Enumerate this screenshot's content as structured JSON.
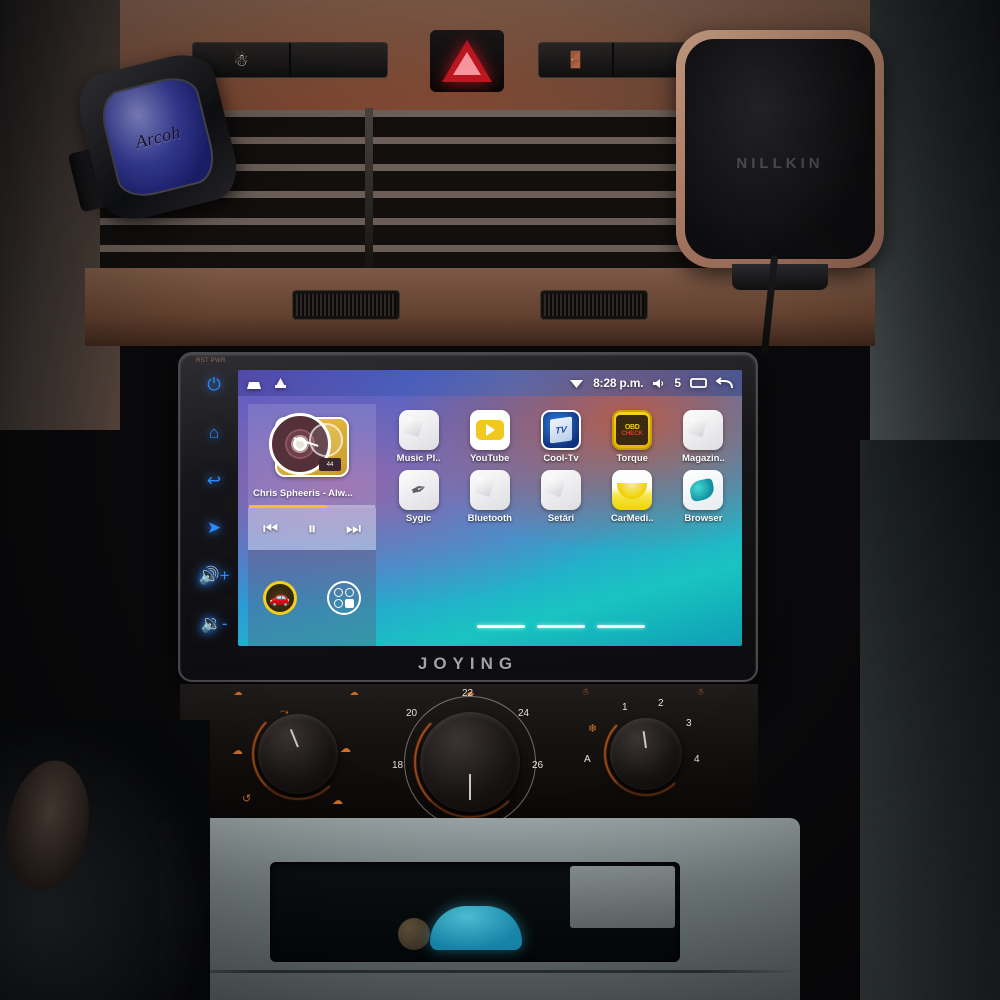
{
  "device": {
    "brand": "JOYING",
    "bezel_label": "RST PWR"
  },
  "hardware_keys": [
    {
      "name": "power-key",
      "glyph": "⏻"
    },
    {
      "name": "home-key",
      "glyph": "⌂"
    },
    {
      "name": "back-key",
      "glyph": "↩"
    },
    {
      "name": "navigation-key",
      "glyph": "➤"
    },
    {
      "name": "volume-up-key",
      "glyph": "🔊+"
    },
    {
      "name": "volume-down-key",
      "glyph": "🔉-"
    }
  ],
  "status_bar": {
    "home_icon": "⌂",
    "apps_icon": "⌂",
    "wifi_icon": "wifi",
    "time": "8:28 p.m.",
    "volume_icon": "speaker",
    "volume_level": "5",
    "recents_icon": "recents",
    "back_icon": "↩"
  },
  "music_widget": {
    "track": "Chris Spheeris - Alw...",
    "display_text": "44",
    "progress_percent": 62,
    "controls": {
      "previous": "⏮",
      "pause": "⏸",
      "next": "⏭"
    },
    "dock": {
      "car_label": "car-mode",
      "car_glyph": "🚗",
      "apps_label": "app-drawer"
    }
  },
  "apps": [
    {
      "label": "Music Pl..",
      "icon": "music-player-icon",
      "style": "blank"
    },
    {
      "label": "YouTube",
      "icon": "youtube-icon",
      "style": "youtube"
    },
    {
      "label": "Cool-Tv",
      "icon": "cool-tv-icon",
      "style": "cooltv",
      "badge": "TV"
    },
    {
      "label": "Torque",
      "icon": "torque-obd-icon",
      "style": "torque",
      "badge_top": "OBD",
      "badge_bottom": "CHECK"
    },
    {
      "label": "Magazin..",
      "icon": "play-store-icon",
      "style": "blank"
    },
    {
      "label": "Sygic",
      "icon": "sygic-navigation-icon",
      "style": "sygic"
    },
    {
      "label": "Bluetooth",
      "icon": "bluetooth-icon",
      "style": "blank"
    },
    {
      "label": "Setări",
      "icon": "settings-icon",
      "style": "blank"
    },
    {
      "label": "CarMedi..",
      "icon": "carmedia-icon",
      "style": "carmedia"
    },
    {
      "label": "Browser",
      "icon": "browser-icon",
      "style": "browser"
    }
  ],
  "page_indicator": {
    "pages": 3,
    "current": 1
  },
  "climate": {
    "airflow_knob": {
      "name": "airflow-direction-knob",
      "glyphs": [
        "⤳",
        "☁",
        "☁",
        "↺",
        "☁"
      ]
    },
    "temperature_knob": {
      "name": "temperature-knob",
      "marks": [
        "18",
        "20",
        "22",
        "24",
        "26"
      ]
    },
    "fan_knob": {
      "name": "fan-speed-knob",
      "marks": [
        "A",
        "1",
        "2",
        "3",
        "4"
      ],
      "auto_glyph": "❄"
    },
    "top_icons": [
      "☁",
      "☁",
      "☁",
      "☃",
      "☃"
    ]
  },
  "dash": {
    "hazard_button": "hazard-warning-button",
    "seat_heater_button": "seat-heater-button",
    "seat_heater_glyph": "☃",
    "door_lock_button": "central-lock-button",
    "door_lock_glyph": "🚪",
    "air_freshener_label": "Arcoh",
    "phone_mount_brand": "NILLKIN"
  }
}
